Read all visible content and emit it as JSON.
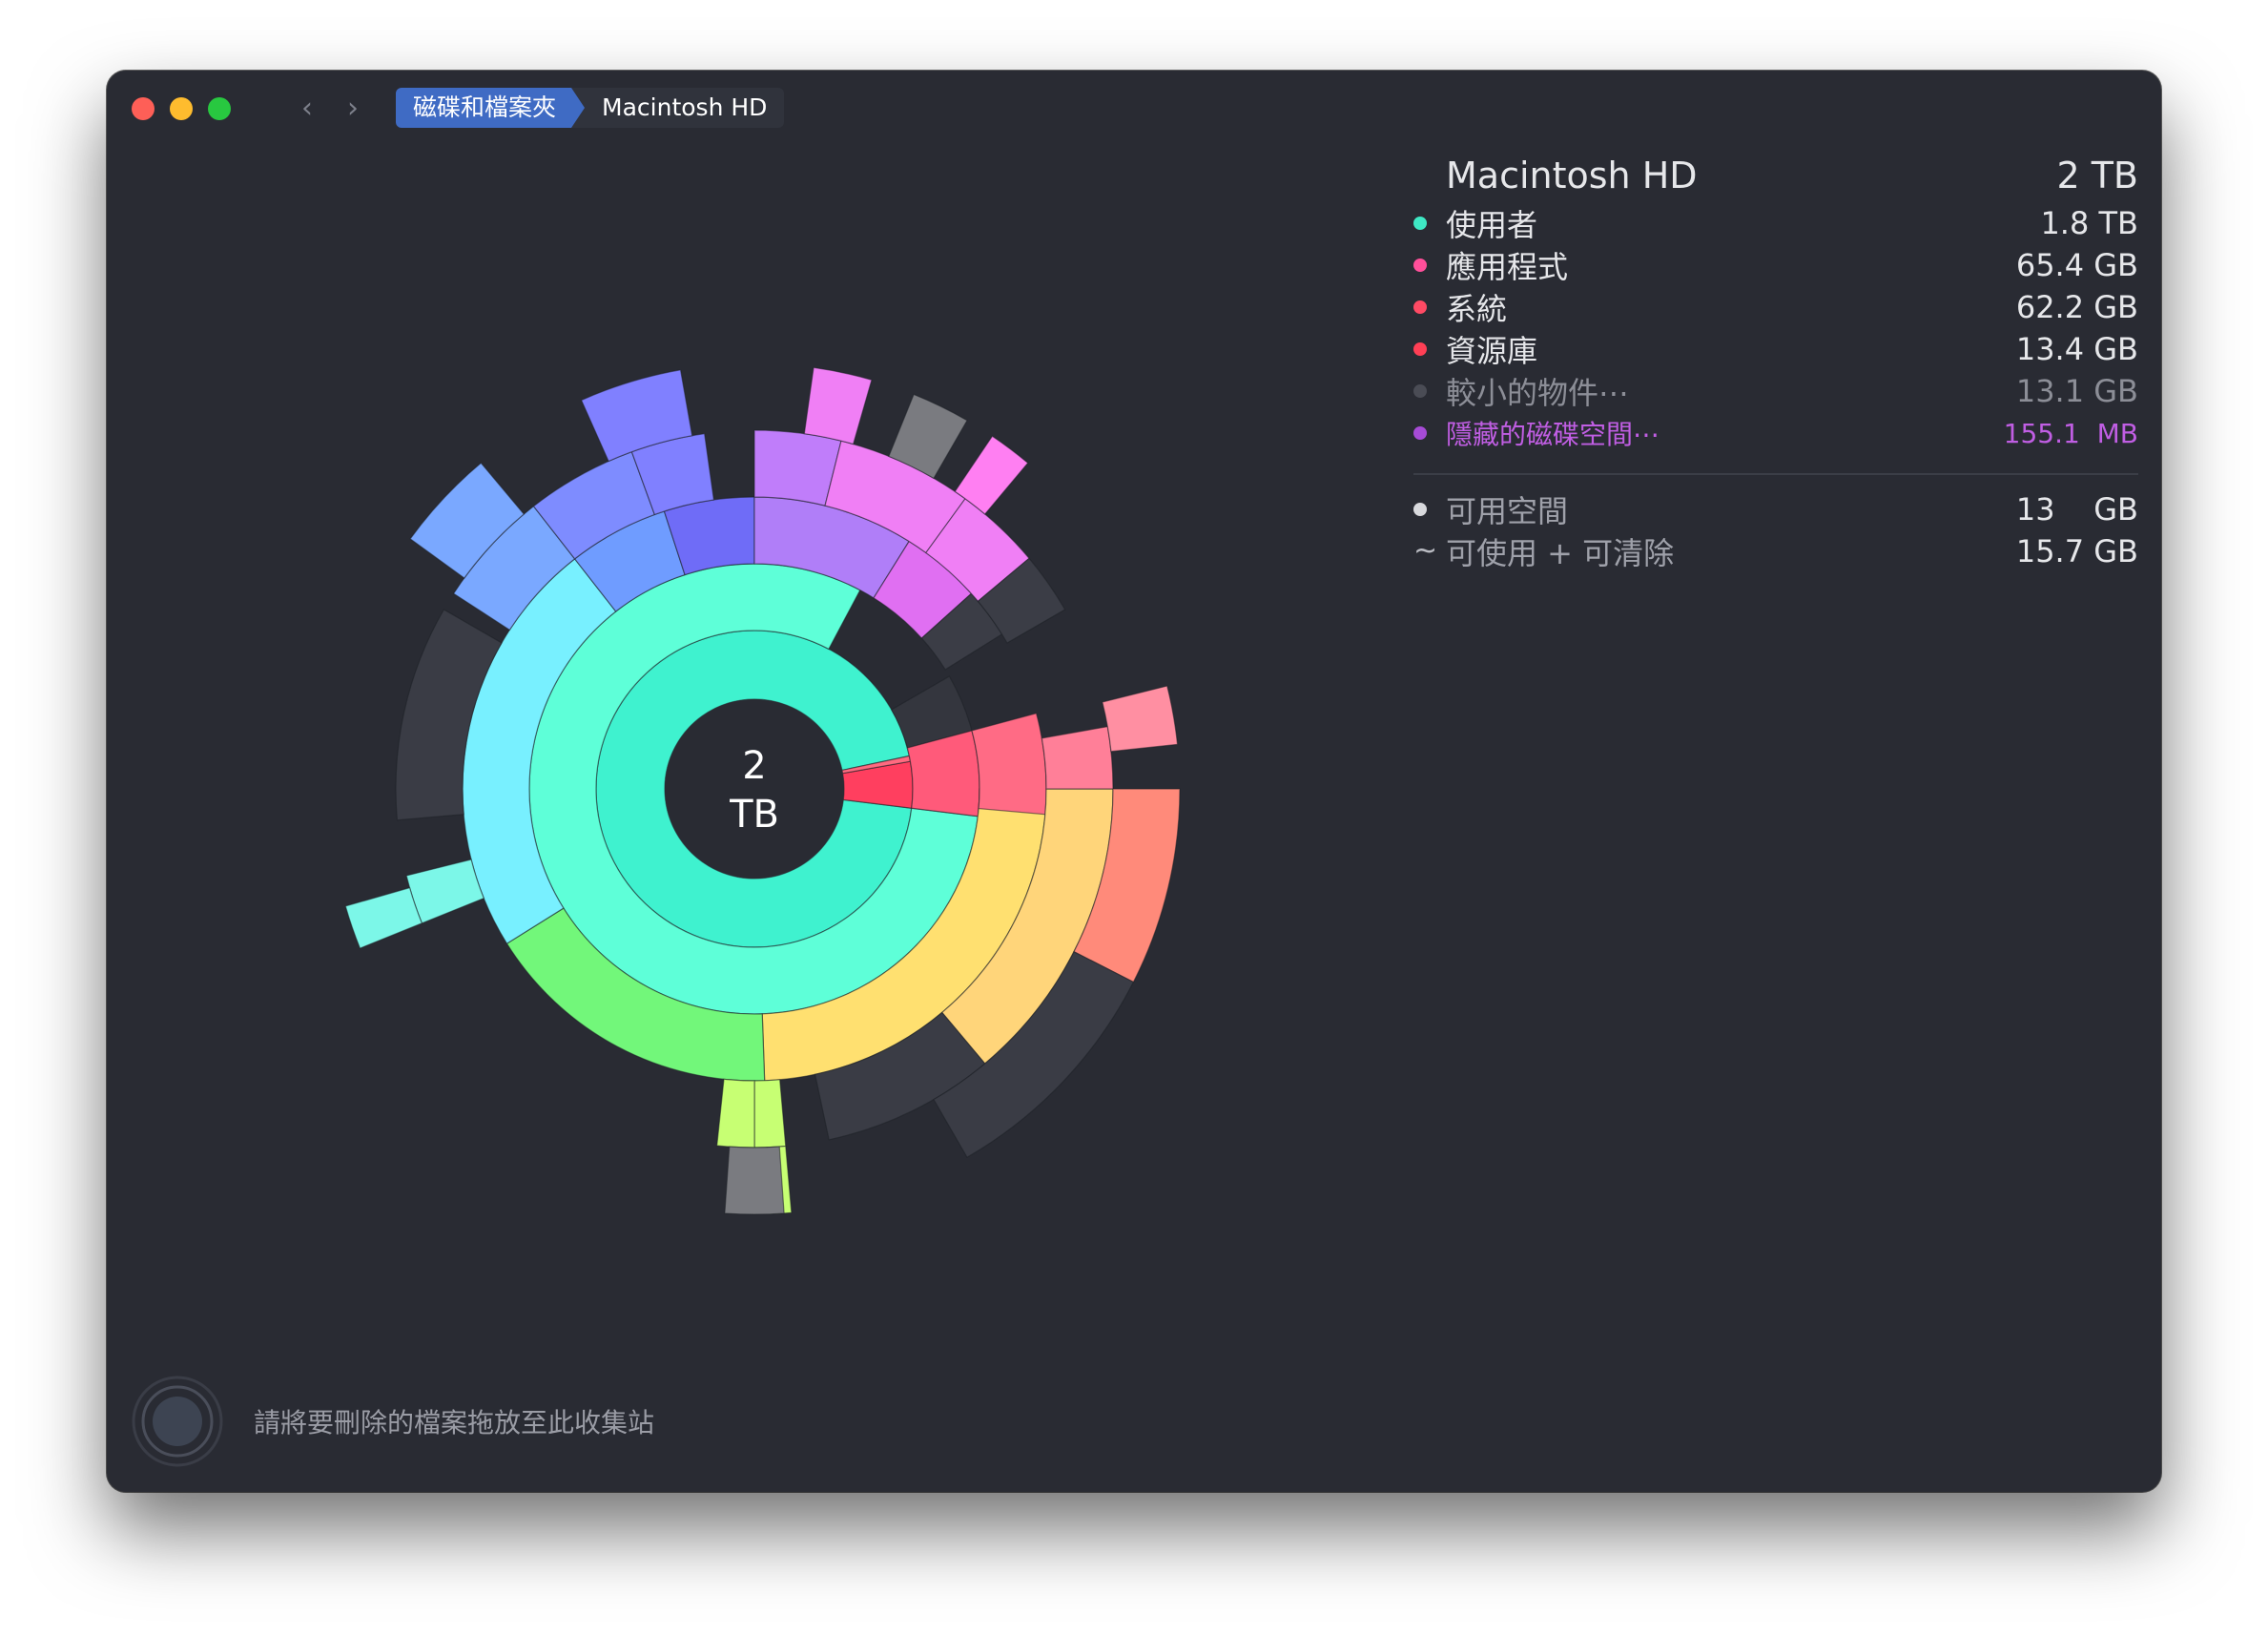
{
  "window": {
    "breadcrumb": [
      "磁碟和檔案夾",
      "Macintosh HD"
    ]
  },
  "chart": {
    "center_value": "2",
    "center_unit": "TB"
  },
  "panel": {
    "title": "Macintosh HD",
    "total": "2 TB",
    "items": [
      {
        "label": "使用者",
        "value": "1.8 TB",
        "color": "#3ee8c4",
        "text_color": "#e6e7ea"
      },
      {
        "label": "應用程式",
        "value": "65.4 GB",
        "color": "#ff4f9a",
        "text_color": "#e6e7ea"
      },
      {
        "label": "系統",
        "value": "62.2 GB",
        "color": "#ff4a64",
        "text_color": "#e6e7ea"
      },
      {
        "label": "資源庫",
        "value": "13.4 GB",
        "color": "#ff3f55",
        "text_color": "#e6e7ea"
      },
      {
        "label": "較小的物件⋯",
        "value": "13.1 GB",
        "color": "#4a4c55",
        "text_color": "#8c8e97"
      },
      {
        "label": "隱藏的磁碟空間⋯",
        "value": "155.1  MB",
        "color": "#a64bd6",
        "text_color": "#c05ee3"
      }
    ],
    "free": [
      {
        "label": "可用空間",
        "value": "13    GB",
        "marker": "dot"
      },
      {
        "label": "可使用 + 可清除",
        "value": "15.7 GB",
        "marker": "~"
      }
    ]
  },
  "footer": {
    "hint": "請將要刪除的檔案拖放至此收集站"
  }
}
